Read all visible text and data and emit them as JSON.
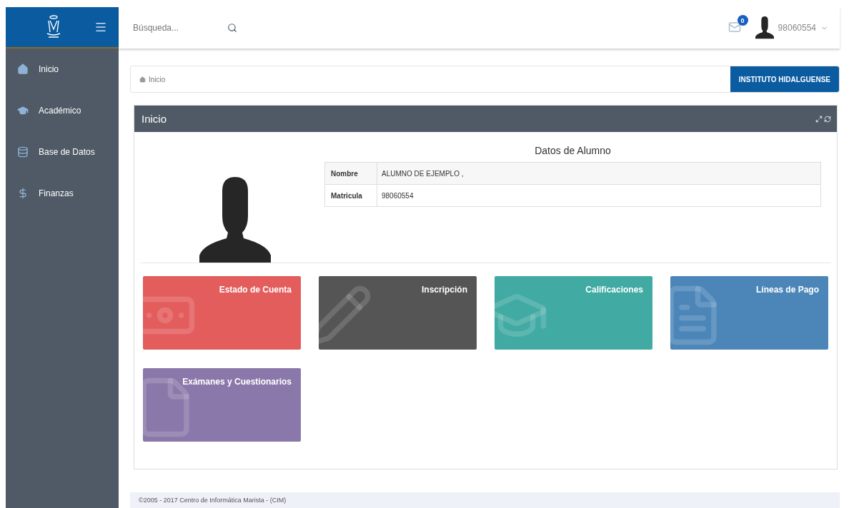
{
  "header": {
    "search": {
      "placeholder": "Búsqueda..."
    },
    "messages_badge": "0",
    "user": "98060554"
  },
  "sidebar": {
    "items": [
      {
        "label": "Inicio",
        "kind": "home",
        "selected": false
      },
      {
        "label": "Académico",
        "kind": "cap",
        "selected": false
      },
      {
        "label": "Base de Datos",
        "kind": "database",
        "selected": false
      },
      {
        "label": "Finanzas",
        "kind": "dollar",
        "selected": false
      }
    ]
  },
  "breadcrumb": {
    "label": "Inicio",
    "institution": "INSTITUTO HIDALGUENSE"
  },
  "panel": {
    "title": "Inicio",
    "student": {
      "title": "Datos de Alumno",
      "rows": [
        {
          "label": "Nombre",
          "value": "ALUMNO DE EJEMPLO ,"
        },
        {
          "label": "Matricula",
          "value": "98060554"
        }
      ]
    },
    "tiles": [
      {
        "label": "Estado de Cuenta",
        "color": "#e35d5d",
        "kind": "money"
      },
      {
        "label": "Inscripción",
        "color": "#555555",
        "kind": "pencil"
      },
      {
        "label": "Calificaciones",
        "color": "#41aaa3",
        "kind": "cap"
      },
      {
        "label": "Líneas de Pago",
        "color": "#4c86b9",
        "kind": "file"
      },
      {
        "label": "Exámanes y Cuestionarios",
        "color": "#8b78aa",
        "kind": "doc"
      }
    ]
  },
  "footer": "©2005 - 2017 Centro de Informática Marista - (CIM)"
}
